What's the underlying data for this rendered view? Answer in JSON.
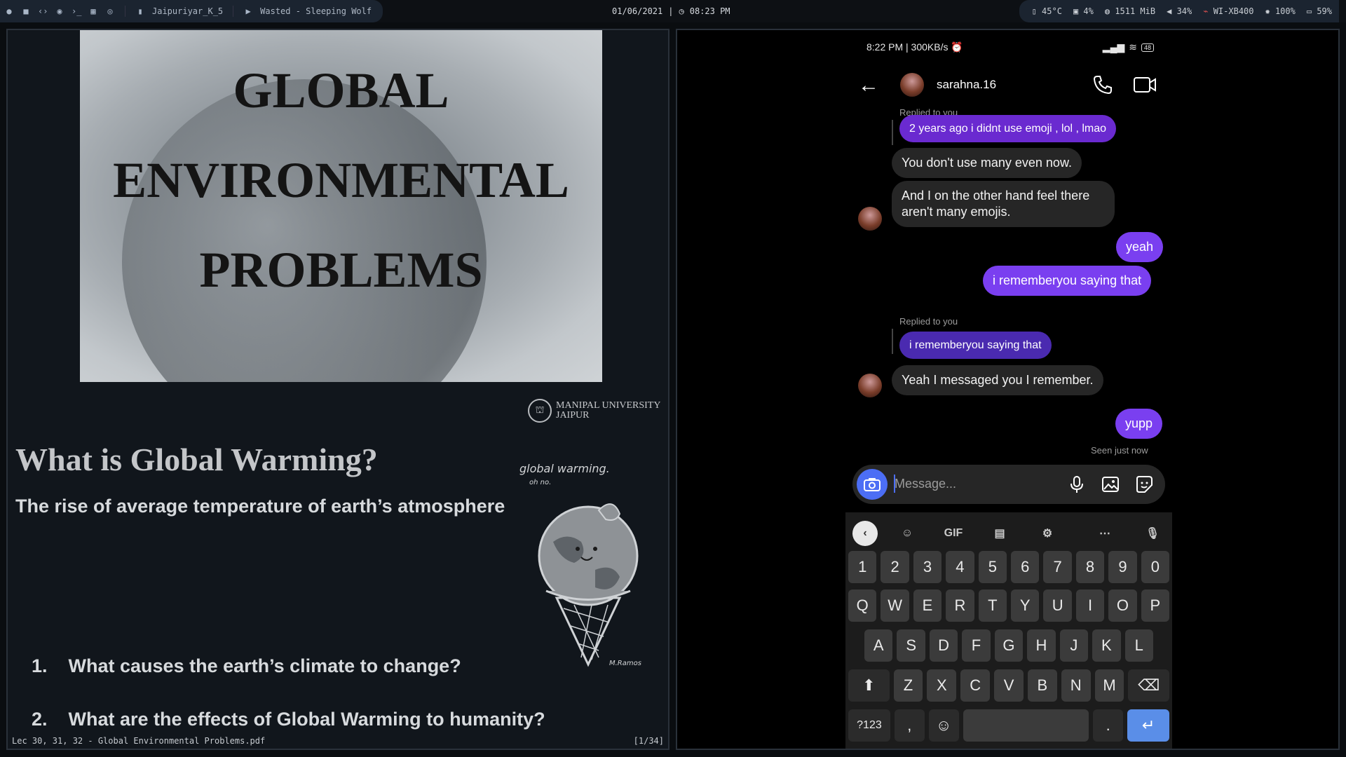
{
  "topbar": {
    "workspace_label": "Jaipuriyar_K_5",
    "now_playing": "Wasted - Sleeping Wolf",
    "date": "01/06/2021",
    "time": "08:23 PM",
    "temp": "45°C",
    "cpu": "4%",
    "memory": "1511 MiB",
    "volume": "34%",
    "network": "WI-XB400",
    "brightness": "100%",
    "battery": "59%"
  },
  "pdf": {
    "slide_title": [
      "GLOBAL",
      "ENVIRONMENTAL",
      "PROBLEMS"
    ],
    "logo_line1": "MANIPAL UNIVERSITY",
    "logo_line2": "JAIPUR",
    "heading": "What is Global Warming?",
    "subtitle": "The rise of average temperature of earth’s atmosphere",
    "doodle_caption": "global warming.",
    "doodle_sub": "oh no.",
    "doodle_sign": "M.Ramos",
    "questions": [
      {
        "num": "1.",
        "text": "What causes the earth’s climate to change?"
      },
      {
        "num": "2.",
        "text": "What are the effects of Global Warming to humanity?"
      }
    ],
    "status_left": "Lec 30, 31, 32 - Global Environmental Problems.pdf",
    "status_right": "[1/34]"
  },
  "phone": {
    "status_time": "8:22 PM | 300KB/s",
    "battery": "48",
    "username": "sarahna.16",
    "replied_top": "Replied to you",
    "messages": [
      {
        "text": "2 years ago i didnt use emoji , lol , lmao"
      },
      {
        "text": "You don't use many even now."
      },
      {
        "text": "And I on the other hand feel there aren't many emojis."
      },
      {
        "text": "yeah"
      },
      {
        "text": "i rememberyou saying that"
      },
      {
        "text": "i rememberyou saying that"
      },
      {
        "text": "Yeah I messaged you I remember."
      },
      {
        "text": "yupp"
      }
    ],
    "replied_label": "Replied to you",
    "seen": "Seen just now",
    "composer_placeholder": "Message...",
    "keyboard": {
      "gif": "GIF",
      "numbers": [
        "1",
        "2",
        "3",
        "4",
        "5",
        "6",
        "7",
        "8",
        "9",
        "0"
      ],
      "row1": [
        "Q",
        "W",
        "E",
        "R",
        "T",
        "Y",
        "U",
        "I",
        "O",
        "P"
      ],
      "row2": [
        "A",
        "S",
        "D",
        "F",
        "G",
        "H",
        "J",
        "K",
        "L"
      ],
      "row3": [
        "Z",
        "X",
        "C",
        "V",
        "B",
        "N",
        "M"
      ],
      "sym": "?123",
      "comma": ",",
      "period": "."
    }
  }
}
